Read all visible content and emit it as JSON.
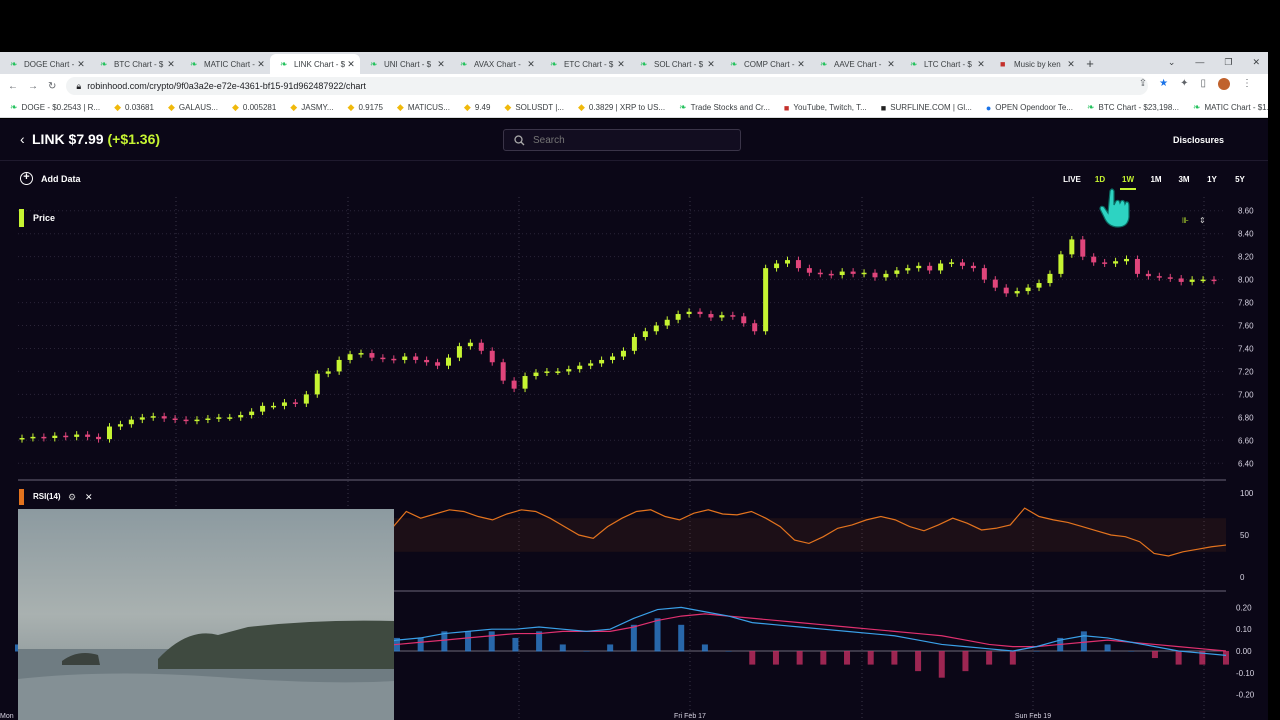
{
  "browser": {
    "tabs": [
      {
        "label": "DOGE Chart - $",
        "icon": "robinhood-feather-icon",
        "active": false
      },
      {
        "label": "BTC Chart - $",
        "icon": "robinhood-feather-icon",
        "active": false
      },
      {
        "label": "MATIC Chart -",
        "icon": "robinhood-feather-icon",
        "active": false
      },
      {
        "label": "LINK Chart - $",
        "icon": "robinhood-feather-icon",
        "active": true
      },
      {
        "label": "UNI Chart - $",
        "icon": "robinhood-feather-icon",
        "active": false
      },
      {
        "label": "AVAX Chart -",
        "icon": "robinhood-feather-icon",
        "active": false
      },
      {
        "label": "ETC Chart - $",
        "icon": "robinhood-feather-icon",
        "active": false
      },
      {
        "label": "SOL Chart - $",
        "icon": "robinhood-feather-icon",
        "active": false
      },
      {
        "label": "COMP Chart -",
        "icon": "robinhood-feather-icon",
        "active": false
      },
      {
        "label": "AAVE Chart -",
        "icon": "robinhood-feather-icon",
        "active": false
      },
      {
        "label": "LTC Chart - $",
        "icon": "robinhood-feather-icon",
        "active": false
      },
      {
        "label": "Music by ken",
        "icon": "music-icon",
        "active": false
      }
    ],
    "url": "robinhood.com/crypto/9f0a3a2e-e72e-4361-bf15-91d962487922/chart",
    "bookmarks": [
      {
        "label": "DOGE - $0.2543 | R...",
        "color": "g"
      },
      {
        "label": "0.03681",
        "color": "y"
      },
      {
        "label": "GALAUS...",
        "color": "y"
      },
      {
        "label": "0.005281",
        "color": "y"
      },
      {
        "label": "JASMY...",
        "color": "y"
      },
      {
        "label": "0.9175",
        "color": "y"
      },
      {
        "label": "MATICUS...",
        "color": "y"
      },
      {
        "label": "9.49",
        "color": "y"
      },
      {
        "label": "SOLUSDT |...",
        "color": "y"
      },
      {
        "label": "0.3829 | XRP to US...",
        "color": "y"
      },
      {
        "label": "Trade Stocks and Cr...",
        "color": "g"
      },
      {
        "label": "YouTube, Twitch, T...",
        "color": "r"
      },
      {
        "label": "SURFLINE.COM | Gl...",
        "color": "k"
      },
      {
        "label": "OPEN Opendoor Te...",
        "color": "b"
      },
      {
        "label": "BTC Chart - $23,198...",
        "color": "g"
      },
      {
        "label": "MATIC Chart - $1.1...",
        "color": "g"
      }
    ]
  },
  "header": {
    "ticker": "LINK $7.99",
    "change": "(+$1.36)",
    "search_placeholder": "Search",
    "disclosures": "Disclosures"
  },
  "toolbar": {
    "add_data": "Add Data",
    "ranges": [
      "LIVE",
      "1D",
      "1W",
      "1M",
      "3M",
      "1Y",
      "5Y"
    ],
    "selected_range": "1W"
  },
  "panels": {
    "price_label": "Price",
    "rsi_label": "RSI(14)"
  },
  "colors": {
    "up": "#c6f432",
    "down": "#e0457b",
    "rsi": "#e3731e",
    "macd": "#3aa0e8",
    "signal": "#e0306f",
    "background": "#0b0717"
  },
  "chart_data": [
    {
      "type": "candlestick",
      "title": "Price",
      "y_ticks": [
        "8.60",
        "8.40",
        "8.20",
        "8.00",
        "7.80",
        "7.60",
        "7.40",
        "7.20",
        "7.00",
        "6.80",
        "6.60",
        "6.40"
      ],
      "ylim": [
        6.35,
        8.65
      ],
      "close_series": [
        6.62,
        6.63,
        6.62,
        6.64,
        6.63,
        6.65,
        6.63,
        6.61,
        6.72,
        6.74,
        6.78,
        6.8,
        6.81,
        6.79,
        6.78,
        6.77,
        6.78,
        6.79,
        6.8,
        6.8,
        6.82,
        6.85,
        6.9,
        6.9,
        6.93,
        6.92,
        7.0,
        7.18,
        7.2,
        7.3,
        7.35,
        7.36,
        7.32,
        7.31,
        7.3,
        7.33,
        7.3,
        7.28,
        7.25,
        7.32,
        7.42,
        7.45,
        7.38,
        7.28,
        7.12,
        7.05,
        7.16,
        7.19,
        7.2,
        7.2,
        7.22,
        7.25,
        7.27,
        7.3,
        7.33,
        7.38,
        7.5,
        7.55,
        7.6,
        7.65,
        7.7,
        7.72,
        7.7,
        7.67,
        7.69,
        7.68,
        7.62,
        7.55,
        8.1,
        8.14,
        8.17,
        8.1,
        8.06,
        8.05,
        8.04,
        8.07,
        8.05,
        8.06,
        8.02,
        8.05,
        8.08,
        8.1,
        8.12,
        8.08,
        8.14,
        8.15,
        8.12,
        8.1,
        8.0,
        7.93,
        7.88,
        7.9,
        7.93,
        7.97,
        8.05,
        8.22,
        8.35,
        8.2,
        8.15,
        8.14,
        8.16,
        8.18,
        8.05,
        8.03,
        8.02,
        8.01,
        7.98,
        8.0,
        8.0,
        7.99
      ],
      "x_ticks": [
        "Mon",
        "Fri Feb 17",
        "Sun Feb 19"
      ]
    },
    {
      "type": "line",
      "title": "RSI(14)",
      "y_ticks": [
        "100",
        "50",
        "0"
      ],
      "ylim": [
        0,
        100
      ],
      "values": [
        78,
        76,
        74,
        72,
        70,
        72,
        74,
        70,
        65,
        55,
        50,
        45,
        40,
        46,
        48,
        42,
        38,
        32,
        40,
        45,
        50,
        55,
        48,
        40,
        35,
        42,
        58,
        78,
        70,
        75,
        80,
        78,
        72,
        68,
        75,
        80,
        78,
        70,
        60,
        50,
        46,
        60,
        70,
        78,
        80,
        72,
        68,
        76,
        80,
        75,
        74,
        78,
        70,
        60,
        44,
        40,
        48,
        58,
        62,
        68,
        72,
        68,
        60,
        55,
        62,
        70,
        64,
        56,
        58,
        62,
        82,
        72,
        68,
        65,
        60,
        55,
        50,
        48,
        42,
        28,
        25,
        30,
        33,
        36,
        38
      ]
    },
    {
      "type": "line",
      "title": "MACD",
      "y_ticks": [
        "0.20",
        "0.10",
        "0.00",
        "-0.10",
        "-0.20"
      ],
      "ylim": [
        -0.22,
        0.22
      ],
      "series": [
        {
          "values": [
            0.12,
            0.11,
            0.1,
            0.08,
            0.07,
            0.08,
            0.06,
            0.04,
            0.03,
            0.02,
            0.01,
            0.0,
            -0.01,
            0.0,
            0.02,
            0.03,
            0.05,
            0.06,
            0.08,
            0.09,
            0.1,
            0.1,
            0.11,
            0.1,
            0.09,
            0.1,
            0.15,
            0.19,
            0.2,
            0.18,
            0.16,
            0.13,
            0.12,
            0.11,
            0.1,
            0.09,
            0.08,
            0.07,
            0.05,
            0.03,
            0.02,
            0.01,
            0.0,
            0.02,
            0.05,
            0.07,
            0.06,
            0.04,
            0.02,
            0.0,
            -0.01,
            -0.02
          ]
        },
        {
          "values": [
            0.11,
            0.1,
            0.1,
            0.09,
            0.08,
            0.07,
            0.06,
            0.05,
            0.04,
            0.03,
            0.02,
            0.01,
            0.0,
            0.0,
            0.01,
            0.02,
            0.03,
            0.04,
            0.05,
            0.06,
            0.07,
            0.08,
            0.08,
            0.09,
            0.09,
            0.09,
            0.11,
            0.14,
            0.16,
            0.17,
            0.16,
            0.15,
            0.14,
            0.13,
            0.12,
            0.11,
            0.1,
            0.09,
            0.08,
            0.07,
            0.05,
            0.03,
            0.02,
            0.02,
            0.03,
            0.04,
            0.05,
            0.04,
            0.03,
            0.02,
            0.01,
            0.0
          ]
        }
      ]
    }
  ]
}
